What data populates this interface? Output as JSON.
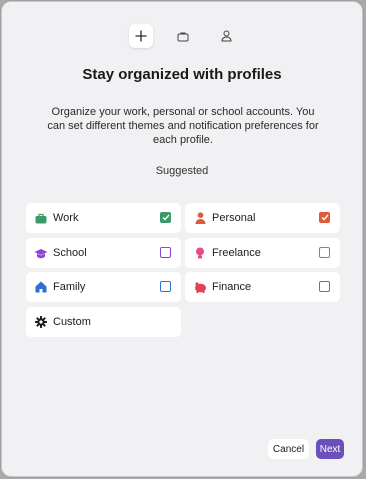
{
  "header": {
    "icons": [
      "plus-icon",
      "briefcase-icon",
      "person-icon"
    ]
  },
  "title": "Stay organized with profiles",
  "description": "Organize your work, personal or school accounts. You can set different themes and notification preferences for each profile.",
  "section_label": "Suggested",
  "profiles": [
    {
      "label": "Work",
      "icon": "briefcase-icon",
      "color": "#3d9a68",
      "checked": true
    },
    {
      "label": "Personal",
      "icon": "person-icon",
      "color": "#e05a3a",
      "checked": true
    },
    {
      "label": "School",
      "icon": "graduation-cap-icon",
      "color": "#8b44d6",
      "checked": false
    },
    {
      "label": "Freelance",
      "icon": "lightbulb-icon",
      "color": "#e84c8a",
      "checked": false
    },
    {
      "label": "Family",
      "icon": "house-icon",
      "color": "#2f6fd6",
      "checked": false
    },
    {
      "label": "Finance",
      "icon": "piggy-bank-icon",
      "color": "#e3405a",
      "checked": false
    },
    {
      "label": "Custom",
      "icon": "gear-icon",
      "color": "#1c1c1c",
      "checked": null
    }
  ],
  "buttons": {
    "cancel": "Cancel",
    "next": "Next"
  },
  "colors": {
    "accent": "#6b4fbb",
    "dialog_bg": "#f1f1f3",
    "card_bg": "#ffffff"
  }
}
